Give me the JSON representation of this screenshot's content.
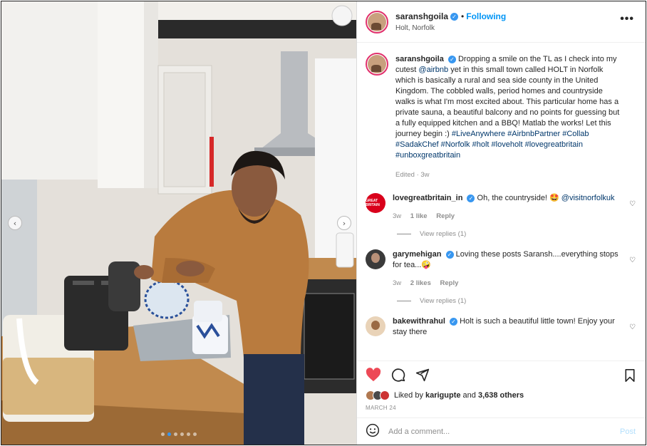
{
  "post": {
    "author": "saranshgoila",
    "follow_status": "Following",
    "separator": "•",
    "location": "Holt, Norfolk",
    "more": "•••",
    "caption_text": "Dropping a smile on the TL as I check into my cutest ",
    "caption_mention": "@airbnb",
    "caption_rest": " yet in this small town called HOLT in Norfolk which is basically a rural and sea side county in the United Kingdom. The cobbled walls, period homes and countryside walks is what I'm most excited about. This particular home has a private sauna, a beautiful balcony and no points for guessing but a fully equipped kitchen and a BBQ! Matlab the works! Let this journey begin :)",
    "hashtags": "#LiveAnywhere #AirbnbPartner #Collab #SadakChef #Norfolk #holt #loveholt #lovegreatbritain #unboxgreatbritain",
    "edited": "Edited · 3w"
  },
  "comments": [
    {
      "user": "lovegreatbritain_in",
      "avatar_text": "GREAT BRITAIN",
      "text": "Oh, the countryside! 🤩 ",
      "mention": "@visitnorfolkuk",
      "age": "3w",
      "likes": "1 like",
      "reply": "Reply",
      "view_replies": "View replies (1)"
    },
    {
      "user": "garymehigan",
      "text": "Loving these posts Saransh....everything stops for tea...🤪",
      "age": "3w",
      "likes": "2 likes",
      "reply": "Reply",
      "view_replies": "View replies (1)"
    },
    {
      "user": "bakewithrahul",
      "text": "Holt is such a beautiful little town! Enjoy your stay there"
    }
  ],
  "likes": {
    "prefix": "Liked by ",
    "first_user": "karigupte",
    "middle": " and ",
    "others": "3,638 others"
  },
  "date": "MARCH 24",
  "add_comment": {
    "placeholder": "Add a comment...",
    "post_label": "Post"
  },
  "carousel": {
    "slide_count": 6,
    "active_index": 1
  },
  "colors": {
    "accent": "#0095f6",
    "like_red": "#ed4956",
    "verified": "#3897f0"
  }
}
